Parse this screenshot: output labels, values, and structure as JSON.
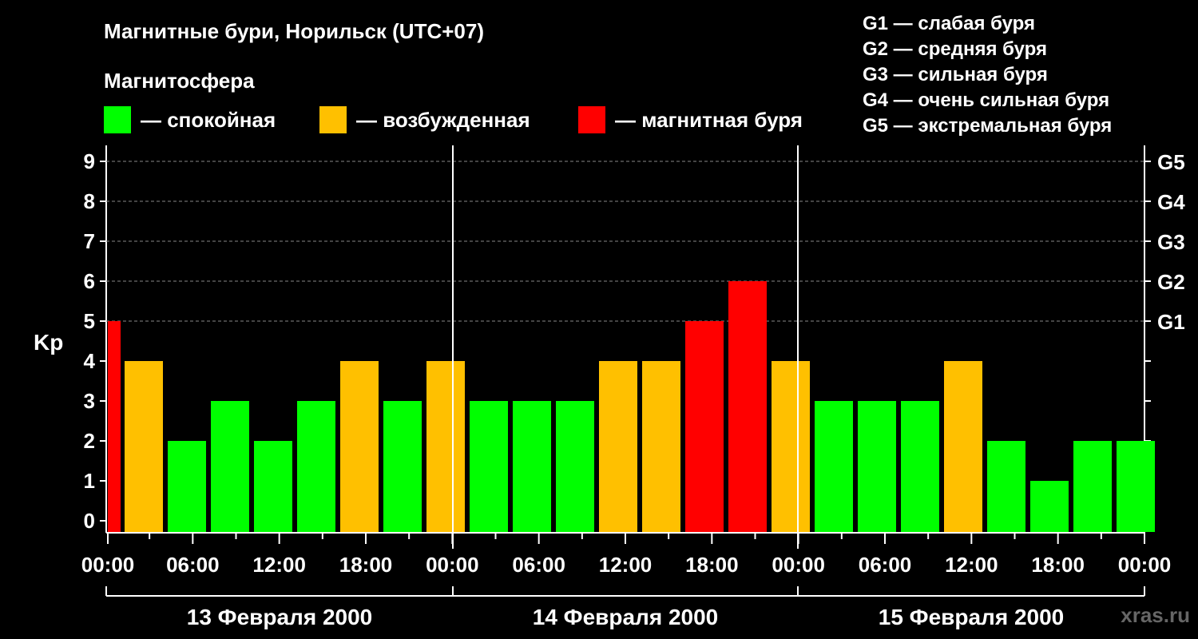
{
  "title": "Магнитные бури, Норильск (UTC+07)",
  "subtitle": "Магнитосфера",
  "legend": [
    {
      "color": "#00ff00",
      "label": "— спокойная"
    },
    {
      "color": "#ffc000",
      "label": "— возбужденная"
    },
    {
      "color": "#ff0000",
      "label": "— магнитная буря"
    }
  ],
  "g_levels": [
    "G1 — слабая буря",
    "G2 — средняя буря",
    "G3 — сильная буря",
    "G4 — очень сильная буря",
    "G5 — экстремальная буря"
  ],
  "watermark": "xras.ru",
  "chart_data": {
    "type": "bar",
    "ylabel": "Kp",
    "ylim": [
      0,
      9
    ],
    "yticks": [
      0,
      1,
      2,
      3,
      4,
      5,
      6,
      7,
      8,
      9
    ],
    "right_labels": [
      {
        "kp": 5,
        "label": "G1"
      },
      {
        "kp": 6,
        "label": "G2"
      },
      {
        "kp": 7,
        "label": "G3"
      },
      {
        "kp": 8,
        "label": "G4"
      },
      {
        "kp": 9,
        "label": "G5"
      }
    ],
    "x_tick_labels": [
      "00:00",
      "06:00",
      "12:00",
      "18:00",
      "00:00",
      "06:00",
      "12:00",
      "18:00",
      "00:00",
      "06:00",
      "12:00",
      "18:00",
      "00:00"
    ],
    "days": [
      "13 Февраля 2000",
      "14 Февраля 2000",
      "15 Февраля 2000"
    ],
    "colors": {
      "quiet": "#00ff00",
      "active": "#ffc000",
      "storm": "#ff0000"
    },
    "values": [
      5,
      4,
      2,
      3,
      2,
      3,
      4,
      3,
      4,
      3,
      3,
      3,
      4,
      4,
      5,
      6,
      4,
      3,
      3,
      3,
      4,
      2,
      1,
      2,
      2
    ],
    "bar_colors": [
      "storm",
      "active",
      "quiet",
      "quiet",
      "quiet",
      "quiet",
      "active",
      "quiet",
      "active",
      "quiet",
      "quiet",
      "quiet",
      "active",
      "active",
      "storm",
      "storm",
      "active",
      "quiet",
      "quiet",
      "quiet",
      "active",
      "quiet",
      "quiet",
      "quiet",
      "quiet"
    ]
  }
}
